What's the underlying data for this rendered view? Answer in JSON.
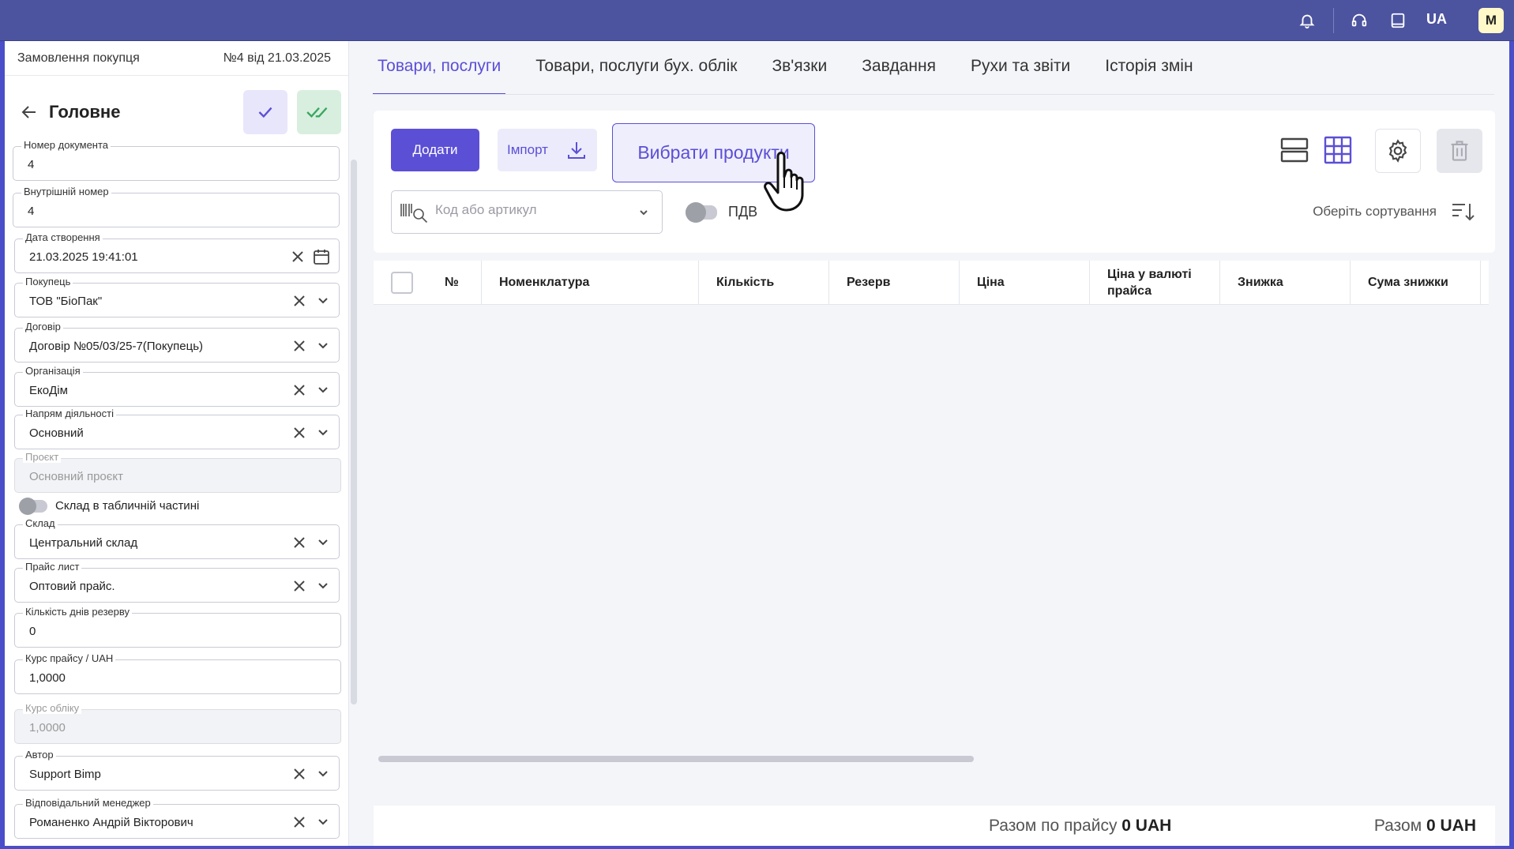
{
  "topbar": {
    "lang": "UA",
    "avatar": "M"
  },
  "left": {
    "doc_type": "Замовлення покупця",
    "doc_number": "№4 від 21.03.2025",
    "section_title": "Головне",
    "fields": {
      "doc_number": {
        "label": "Номер документа",
        "value": "4"
      },
      "internal_number": {
        "label": "Внутрішній номер",
        "value": "4"
      },
      "created": {
        "label": "Дата створення",
        "value": "21.03.2025 19:41:01"
      },
      "buyer": {
        "label": "Покупець",
        "value": "ТОВ \"БіоПак\""
      },
      "contract": {
        "label": "Договір",
        "value": "Договір №05/03/25-7(Покупець)"
      },
      "organization": {
        "label": "Організація",
        "value": "ЕкоДім"
      },
      "activity": {
        "label": "Напрям діяльності",
        "value": "Основний"
      },
      "project": {
        "label": "Проєкт",
        "value": "Основний проєкт"
      },
      "warehouse_toggle": "Склад в табличній частині",
      "warehouse": {
        "label": "Склад",
        "value": "Центральний склад"
      },
      "price_list": {
        "label": "Прайс лист",
        "value": "Оптовий прайс."
      },
      "reserve_days": {
        "label": "Кількість днів резерву",
        "value": "0"
      },
      "price_rate": {
        "label": "Курс прайсу / UAH",
        "value": "1,0000"
      },
      "account_rate": {
        "label": "Курс обліку",
        "value": "1,0000"
      },
      "author": {
        "label": "Автор",
        "value": "Support Bimp"
      },
      "manager": {
        "label": "Відповідальний менеджер",
        "value": "Романенко Андрій Вікторович"
      }
    }
  },
  "tabs": [
    {
      "label": "Товари, послуги",
      "active": true
    },
    {
      "label": "Товари, послуги бух. облік",
      "active": false
    },
    {
      "label": "Зв'язки",
      "active": false
    },
    {
      "label": "Завдання",
      "active": false
    },
    {
      "label": "Рухи та звіти",
      "active": false
    },
    {
      "label": "Історія змін",
      "active": false
    }
  ],
  "toolbar": {
    "add_label": "Додати",
    "import_label": "Імпорт",
    "pick_label": "Вибрати продукти",
    "search_placeholder": "Код або артикул",
    "vat_label": "ПДВ",
    "sort_label": "Оберіть сортування"
  },
  "table": {
    "columns": [
      "№",
      "Номенклатура",
      "Кількість",
      "Резерв",
      "Ціна",
      "Ціна у валюті прайса",
      "Знижка",
      "Сума знижки"
    ],
    "rows": []
  },
  "footer": {
    "price_total_label": "Разом по прайсу",
    "price_total_value": "0 UAH",
    "total_label": "Разом",
    "total_value": "0 UAH"
  },
  "colors": {
    "accent": "#5b4fd6",
    "topbar": "#4c539f",
    "confirm_green": "#3aa860"
  },
  "icons": [
    "bell-icon",
    "headset-icon",
    "book-icon",
    "arrow-left-icon",
    "check-icon",
    "double-check-icon",
    "clear-icon",
    "chevron-down-icon",
    "calendar-icon",
    "download-icon",
    "barcode-search-icon",
    "list-view-icon",
    "grid-view-icon",
    "gear-icon",
    "trash-icon",
    "sort-icon",
    "hand-cursor-icon"
  ]
}
